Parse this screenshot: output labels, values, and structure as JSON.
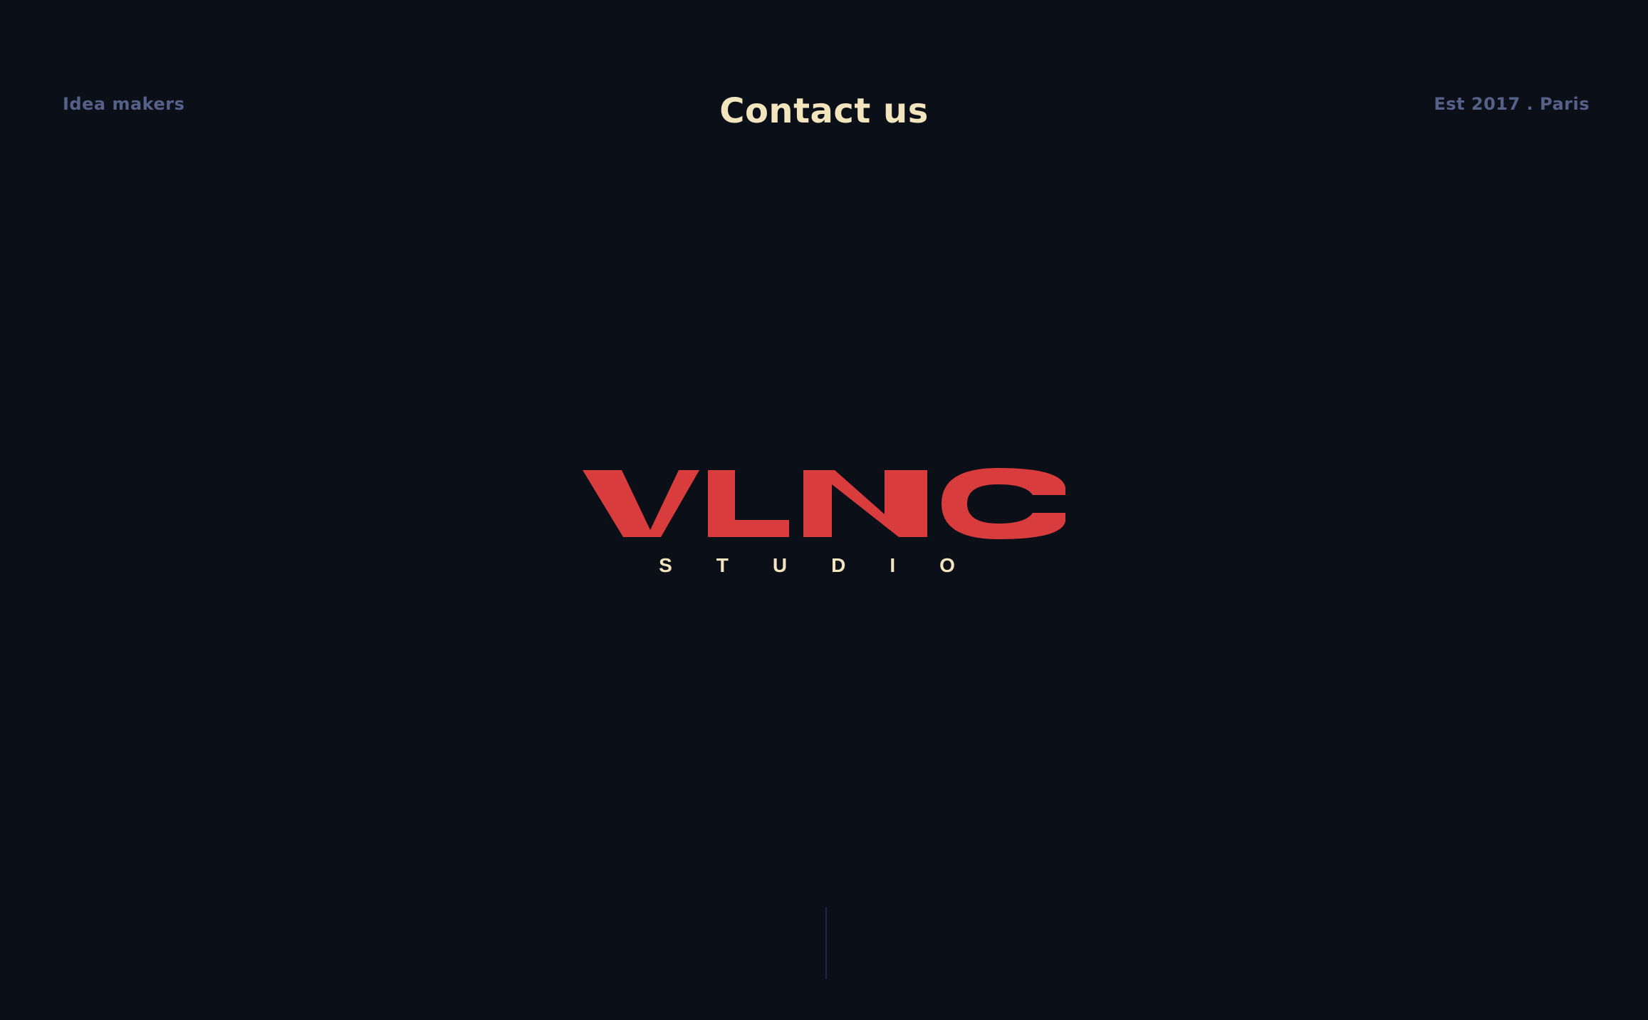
{
  "header": {
    "tagline": "Idea makers",
    "contact_label": "Contact us",
    "established": "Est 2017 . Paris"
  },
  "logo": {
    "wordmark": "VLNC",
    "subtitle": "STUDIO",
    "wordmark_color": "#d83c3c",
    "subtitle_color": "#f2e4bd"
  },
  "colors": {
    "background": "#0b0f17",
    "muted_text": "#56618a",
    "cream": "#f2e4bd",
    "accent_red": "#d83c3c",
    "divider": "#1f2840"
  }
}
